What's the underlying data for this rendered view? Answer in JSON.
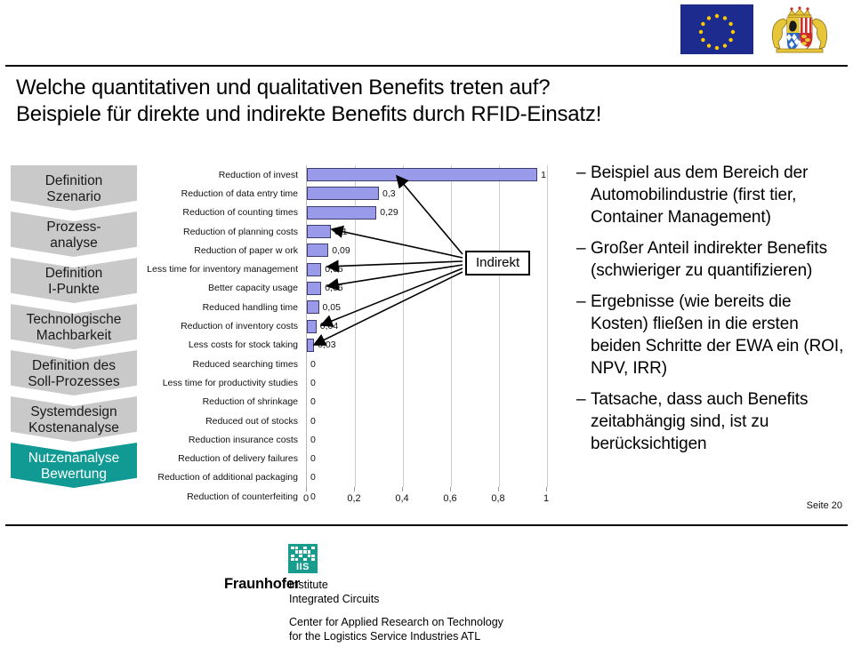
{
  "header": {
    "emblem_eu": "eu-flag",
    "emblem_bavaria": "bavaria-coat-of-arms",
    "colors": {
      "eu_blue": "#1d2b8f",
      "eu_star": "#ffcc00",
      "accent_teal": "#119a94",
      "bar_fill": "#9a9aeb",
      "bar_stroke": "#3b3b6e"
    }
  },
  "title": {
    "line1": "Welche quantitativen und qualitativen Benefits treten auf?",
    "line2": "Beispiele für direkte und indirekte Benefits durch RFID-Einsatz!"
  },
  "sidebar": {
    "items": [
      {
        "line1": "Definition",
        "line2": "Szenario",
        "active": false
      },
      {
        "line1": "Prozess-",
        "line2": "analyse",
        "active": false
      },
      {
        "line1": "Definition",
        "line2": "I-Punkte",
        "active": false
      },
      {
        "line1": "Technologische",
        "line2": "Machbarkeit",
        "active": false
      },
      {
        "line1": "Definition des",
        "line2": "Soll-Prozesses",
        "active": false
      },
      {
        "line1": "Systemdesign",
        "line2": "Kostenanalyse",
        "active": false
      },
      {
        "line1": "Nutzenanalyse",
        "line2": "Bewertung",
        "active": true
      }
    ]
  },
  "chart_data": {
    "type": "bar",
    "orientation": "horizontal",
    "title": "",
    "xlabel": "",
    "ylabel": "",
    "xlim": [
      0,
      1
    ],
    "xticks": [
      "0",
      "0,2",
      "0,4",
      "0,6",
      "0,8",
      "1"
    ],
    "xtick_values": [
      0,
      0.2,
      0.4,
      0.6,
      0.8,
      1
    ],
    "grid": true,
    "legend": "none",
    "categories": [
      "Reduction of invest",
      "Reduction of data entry time",
      "Reduction of counting times",
      "Reduction of planning costs",
      "Reduction of paper w ork",
      "Less time for inventory management",
      "Better capacity usage",
      "Reduced handling time",
      "Reduction of inventory costs",
      "Less costs for stock taking",
      "Reduced searching times",
      "Less time for productivity studies",
      "Reduction of shrinkage",
      "Reduced out of stocks",
      "Reduction insurance costs",
      "Reduction of delivery failures",
      "Reduction of additional packaging",
      "Reduction of counterfeiting"
    ],
    "values": [
      1,
      0.3,
      0.29,
      0.1,
      0.09,
      0.06,
      0.06,
      0.05,
      0.04,
      0.03,
      0,
      0,
      0,
      0,
      0,
      0,
      0,
      0
    ],
    "value_labels": [
      "1",
      "0,3",
      "0,29",
      "0,1",
      "0,09",
      "0,06",
      "0,06",
      "0,05",
      "0,04",
      "0,03",
      "0",
      "0",
      "0",
      "0",
      "0",
      "0",
      "0",
      "0"
    ],
    "annotation": {
      "label": "Indirekt",
      "points_to": [
        "Reduction of invest",
        "Reduction of planning costs",
        "Less time for inventory management",
        "Better capacity usage",
        "Reduction of inventory costs",
        "Less costs for stock taking"
      ]
    }
  },
  "notes": {
    "bullet_marker": "–",
    "items": [
      "Beispiel aus dem Bereich der Automobilindustrie (first tier, Container Management)",
      "Großer Anteil indirekter Benefits (schwieriger zu quantifizieren)",
      "Ergebnisse (wie bereits die Kosten) fließen in die ersten beiden Schritte der EWA ein (ROI, NPV, IRR)",
      "Tatsache, dass auch Benefits zeitabhängig sind, ist zu berücksichtigen"
    ]
  },
  "page_number": "Seite 20",
  "footer_logo": {
    "mark_text": "IIS",
    "wordmark": "Fraunhofer",
    "sub_line1": "Institute",
    "sub_line2": "Integrated Circuits",
    "sub2_line1": "Center for Applied Research on Technology",
    "sub2_line2": "for the Logistics Service Industries ATL"
  }
}
